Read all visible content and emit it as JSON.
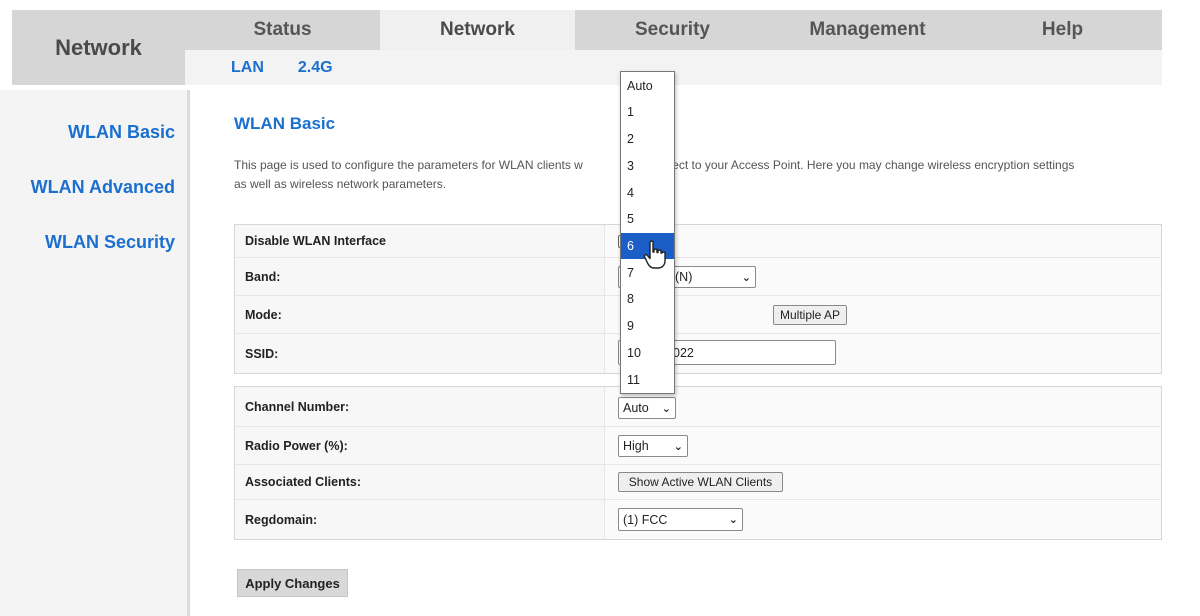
{
  "header": {
    "brand": "Network",
    "tabs": [
      "Status",
      "Network",
      "Security",
      "Management",
      "Help"
    ],
    "active_tab": "Network",
    "subtabs": [
      "LAN",
      "2.4G"
    ]
  },
  "sidebar": {
    "items": [
      "WLAN Basic",
      "WLAN Advanced",
      "WLAN Security"
    ]
  },
  "main": {
    "title": "WLAN Basic",
    "description": "This page is used to configure the parameters for WLAN clients which may connect to your Access Point. Here you may change wireless encryption settings as well as wireless network parameters.",
    "description_visible_line1_start": "This page is used to configure the parameters for WLAN clients w",
    "description_visible_line1_end": "y connect to your Access Point. Here you may change wireless encryption settings",
    "description_line2": "as well as wireless network parameters.",
    "panel1": {
      "disable_label": "Disable WLAN Interface",
      "band_label": "Band:",
      "band_value": "(N)",
      "mode_label": "Mode:",
      "multiple_ap_label": "Multiple AP",
      "ssid_label": "SSID:",
      "ssid_value": "022"
    },
    "panel2": {
      "channel_label": "Channel Number:",
      "channel_value": "Auto",
      "radio_power_label": "Radio Power (%):",
      "radio_power_value": "High",
      "clients_label": "Associated Clients:",
      "clients_button": "Show Active WLAN Clients",
      "regdomain_label": "Regdomain:",
      "regdomain_value": "(1) FCC"
    },
    "apply_label": "Apply Changes"
  },
  "channel_dropdown": {
    "options": [
      "Auto",
      "1",
      "2",
      "3",
      "4",
      "5",
      "6",
      "7",
      "8",
      "9",
      "10",
      "11"
    ],
    "highlighted": "6"
  },
  "colors": {
    "accent": "#1a6fcf",
    "highlight": "#1c5ec7",
    "tab_bg": "#d6d6d6"
  }
}
